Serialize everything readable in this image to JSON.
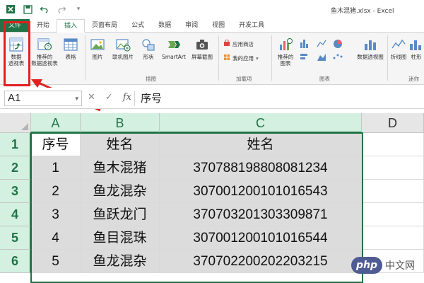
{
  "title_bar": {
    "title": "鱼木混猪.xlsx - Excel",
    "qat_icons": [
      "excel-logo-icon",
      "save-icon",
      "undo-icon",
      "redo-icon"
    ]
  },
  "ribbon_tabs": [
    "文件",
    "开始",
    "插入",
    "页面布局",
    "公式",
    "数据",
    "审阅",
    "视图",
    "开发工具"
  ],
  "ribbon": {
    "buttons": {
      "pivot_table": "数据\n透视表",
      "recommended_pivot": "推荐的\n数据透视表",
      "table": "表格",
      "picture": "图片",
      "online_picture": "联机图片",
      "shapes": "形状",
      "smartart": "SmartArt",
      "screenshot": "屏幕截图",
      "app_store": "应用商店",
      "my_apps": "我的应用",
      "recommended_charts": "推荐的\n图表",
      "pivot_chart": "数据透视图",
      "line_spark": "折线图",
      "column_spark": "柱形"
    },
    "group_labels": {
      "illustrations": "插图",
      "addins": "加载项",
      "charts": "图表",
      "sparklines": "迷你"
    }
  },
  "formula_bar": {
    "name_box": "A1",
    "formula": "序号"
  },
  "sheet": {
    "columns": [
      "A",
      "B",
      "C",
      "D"
    ],
    "rows": [
      "1",
      "2",
      "3",
      "4",
      "5",
      "6"
    ],
    "cells": [
      [
        "序号",
        "姓名",
        "姓名"
      ],
      [
        "1",
        "鱼木混猪",
        "370788198808081234"
      ],
      [
        "2",
        "鱼龙混杂",
        "307001200101016543"
      ],
      [
        "3",
        "鱼跃龙门",
        "370703201303309871"
      ],
      [
        "4",
        "鱼目混珠",
        "307001200101016544"
      ],
      [
        "5",
        "鱼龙混杂",
        "370702200202203215"
      ]
    ]
  },
  "watermark": {
    "logo": "php",
    "text": "中文网"
  },
  "colors": {
    "excel_green": "#217346",
    "highlight_red": "#e02020"
  }
}
